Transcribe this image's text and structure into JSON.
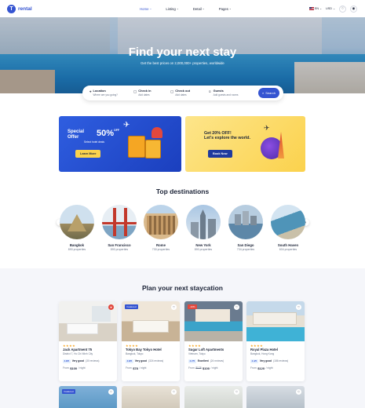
{
  "brand": {
    "name": "rental",
    "mark": "T"
  },
  "nav": {
    "items": [
      {
        "label": "Home",
        "active": true
      },
      {
        "label": "Listing",
        "active": false
      },
      {
        "label": "Detail",
        "active": false
      },
      {
        "label": "Pages",
        "active": false
      }
    ],
    "language": "EN",
    "currency": "USD"
  },
  "hero": {
    "title": "Find your next stay",
    "subtitle": "Get the best prices on 2,000,000+ properties, worldwide"
  },
  "search": {
    "fields": [
      {
        "label": "Location",
        "value": "Where are you going?",
        "icon": "pin-icon"
      },
      {
        "label": "Check in",
        "value": "Add dates",
        "icon": "calendar-icon"
      },
      {
        "label": "Check out",
        "value": "Add dates",
        "icon": "calendar-icon"
      },
      {
        "label": "Guests",
        "value": "Add guests and rooms",
        "icon": "user-icon"
      }
    ],
    "button": "Search"
  },
  "promos": {
    "first": {
      "line1": "Special",
      "line2": "Offer",
      "percent": "50",
      "pct_sign": "%",
      "off": "OFF",
      "sub": "Select hotel deals",
      "button": "Learn More"
    },
    "second": {
      "line1": "Get 20% OFF!",
      "line2": "Let's explore the world.",
      "button": "Book Now"
    }
  },
  "destinations": {
    "title": "Top destinations",
    "items": [
      {
        "name": "Bangkok",
        "count": "890 properties"
      },
      {
        "name": "San Francisco",
        "count": "890 properties"
      },
      {
        "name": "Rome",
        "count": "730 properties"
      },
      {
        "name": "New York",
        "count": "890 properties"
      },
      {
        "name": "San Diego",
        "count": "734 properties"
      },
      {
        "name": "South Haven",
        "count": "604 properties"
      }
    ]
  },
  "staycation": {
    "title": "Plan your next staycation",
    "cards": [
      {
        "name": "Jack Apartment 75",
        "location": "District 7, Ho Chi Minh City",
        "score": "4.8/5",
        "rating": "Very good",
        "reviews": "(30 reviews)",
        "from": "From",
        "price": "$100",
        "unit": "/ night",
        "tag": "",
        "stars": "★★★★"
      },
      {
        "name": "Tokyo Bay Tokyo Hotel",
        "location": "Bangkok, Tokyo",
        "score": "4.8/5",
        "rating": "Very good",
        "reviews": "(324 reviews)",
        "from": "From",
        "price": "$78",
        "unit": "/ night",
        "tag": "Featured",
        "stars": "★★★★"
      },
      {
        "name": "Sugar Loft Apartments",
        "location": "Vietnam, Tokyo",
        "score": "4.7/5",
        "rating": "Excellent",
        "reviews": "(24 reviews)",
        "from": "From",
        "old_price": "$178",
        "price": "$100",
        "unit": "/ night",
        "tag": "-10%",
        "stars": "★★★★"
      },
      {
        "name": "Royal Plaza Hotel",
        "location": "Bangkok, Hong Kong",
        "score": "4.4/5",
        "rating": "Very good",
        "reviews": "(186 reviews)",
        "from": "From",
        "price": "$120",
        "unit": "/ night",
        "tag": "",
        "stars": "★★★★"
      }
    ],
    "second_row_tag": "Featured"
  },
  "colors": {
    "primary": "#3554d1",
    "yellow": "#fbd24d",
    "text": "#1a2236",
    "muted": "#697488",
    "star": "#f8a31a"
  }
}
